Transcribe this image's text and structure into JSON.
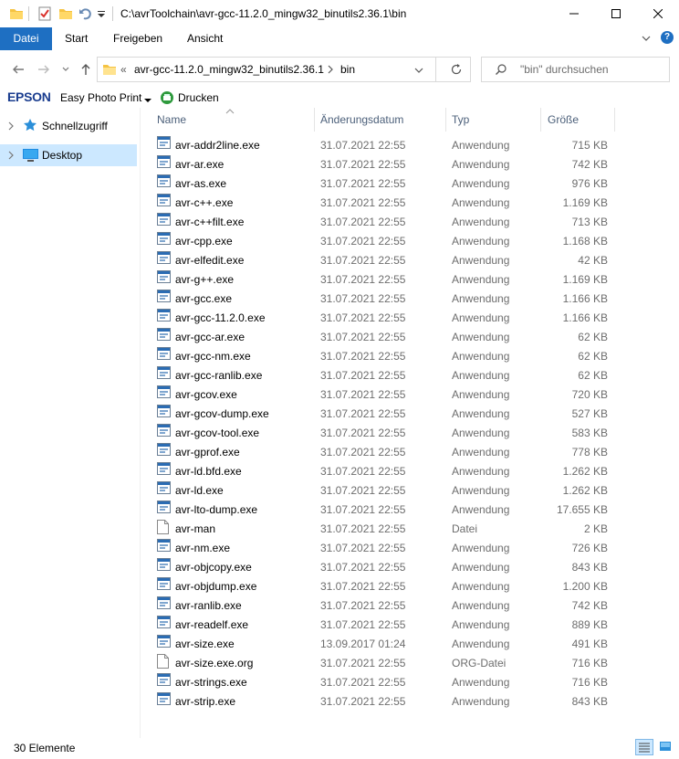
{
  "window": {
    "title": "C:\\avrToolchain\\avr-gcc-11.2.0_mingw32_binutils2.36.1\\bin"
  },
  "ribbon": {
    "tabs": [
      "Datei",
      "Start",
      "Freigeben",
      "Ansicht"
    ]
  },
  "address": {
    "overflow": "«",
    "crumbs": [
      "avr-gcc-11.2.0_mingw32_binutils2.36.1",
      "bin"
    ],
    "search_placeholder": "\"bin\" durchsuchen"
  },
  "toolbar": {
    "epson": "EPSON",
    "easy_photo_print": "Easy Photo Print",
    "print": "Drucken"
  },
  "nav": {
    "items": [
      "Schnellzugriff",
      "Desktop"
    ]
  },
  "columns": {
    "name": "Name",
    "date": "Änderungsdatum",
    "type": "Typ",
    "size": "Größe"
  },
  "files": [
    {
      "name": "avr-addr2line.exe",
      "date": "31.07.2021 22:55",
      "type": "Anwendung",
      "size": "715 KB",
      "icon": "exe"
    },
    {
      "name": "avr-ar.exe",
      "date": "31.07.2021 22:55",
      "type": "Anwendung",
      "size": "742 KB",
      "icon": "exe"
    },
    {
      "name": "avr-as.exe",
      "date": "31.07.2021 22:55",
      "type": "Anwendung",
      "size": "976 KB",
      "icon": "exe"
    },
    {
      "name": "avr-c++.exe",
      "date": "31.07.2021 22:55",
      "type": "Anwendung",
      "size": "1.169 KB",
      "icon": "exe"
    },
    {
      "name": "avr-c++filt.exe",
      "date": "31.07.2021 22:55",
      "type": "Anwendung",
      "size": "713 KB",
      "icon": "exe"
    },
    {
      "name": "avr-cpp.exe",
      "date": "31.07.2021 22:55",
      "type": "Anwendung",
      "size": "1.168 KB",
      "icon": "exe"
    },
    {
      "name": "avr-elfedit.exe",
      "date": "31.07.2021 22:55",
      "type": "Anwendung",
      "size": "42 KB",
      "icon": "exe"
    },
    {
      "name": "avr-g++.exe",
      "date": "31.07.2021 22:55",
      "type": "Anwendung",
      "size": "1.169 KB",
      "icon": "exe"
    },
    {
      "name": "avr-gcc.exe",
      "date": "31.07.2021 22:55",
      "type": "Anwendung",
      "size": "1.166 KB",
      "icon": "exe"
    },
    {
      "name": "avr-gcc-11.2.0.exe",
      "date": "31.07.2021 22:55",
      "type": "Anwendung",
      "size": "1.166 KB",
      "icon": "exe"
    },
    {
      "name": "avr-gcc-ar.exe",
      "date": "31.07.2021 22:55",
      "type": "Anwendung",
      "size": "62 KB",
      "icon": "exe"
    },
    {
      "name": "avr-gcc-nm.exe",
      "date": "31.07.2021 22:55",
      "type": "Anwendung",
      "size": "62 KB",
      "icon": "exe"
    },
    {
      "name": "avr-gcc-ranlib.exe",
      "date": "31.07.2021 22:55",
      "type": "Anwendung",
      "size": "62 KB",
      "icon": "exe"
    },
    {
      "name": "avr-gcov.exe",
      "date": "31.07.2021 22:55",
      "type": "Anwendung",
      "size": "720 KB",
      "icon": "exe"
    },
    {
      "name": "avr-gcov-dump.exe",
      "date": "31.07.2021 22:55",
      "type": "Anwendung",
      "size": "527 KB",
      "icon": "exe"
    },
    {
      "name": "avr-gcov-tool.exe",
      "date": "31.07.2021 22:55",
      "type": "Anwendung",
      "size": "583 KB",
      "icon": "exe"
    },
    {
      "name": "avr-gprof.exe",
      "date": "31.07.2021 22:55",
      "type": "Anwendung",
      "size": "778 KB",
      "icon": "exe"
    },
    {
      "name": "avr-ld.bfd.exe",
      "date": "31.07.2021 22:55",
      "type": "Anwendung",
      "size": "1.262 KB",
      "icon": "exe"
    },
    {
      "name": "avr-ld.exe",
      "date": "31.07.2021 22:55",
      "type": "Anwendung",
      "size": "1.262 KB",
      "icon": "exe"
    },
    {
      "name": "avr-lto-dump.exe",
      "date": "31.07.2021 22:55",
      "type": "Anwendung",
      "size": "17.655 KB",
      "icon": "exe"
    },
    {
      "name": "avr-man",
      "date": "31.07.2021 22:55",
      "type": "Datei",
      "size": "2 KB",
      "icon": "file"
    },
    {
      "name": "avr-nm.exe",
      "date": "31.07.2021 22:55",
      "type": "Anwendung",
      "size": "726 KB",
      "icon": "exe"
    },
    {
      "name": "avr-objcopy.exe",
      "date": "31.07.2021 22:55",
      "type": "Anwendung",
      "size": "843 KB",
      "icon": "exe"
    },
    {
      "name": "avr-objdump.exe",
      "date": "31.07.2021 22:55",
      "type": "Anwendung",
      "size": "1.200 KB",
      "icon": "exe"
    },
    {
      "name": "avr-ranlib.exe",
      "date": "31.07.2021 22:55",
      "type": "Anwendung",
      "size": "742 KB",
      "icon": "exe"
    },
    {
      "name": "avr-readelf.exe",
      "date": "31.07.2021 22:55",
      "type": "Anwendung",
      "size": "889 KB",
      "icon": "exe"
    },
    {
      "name": "avr-size.exe",
      "date": "13.09.2017 01:24",
      "type": "Anwendung",
      "size": "491 KB",
      "icon": "exe"
    },
    {
      "name": "avr-size.exe.org",
      "date": "31.07.2021 22:55",
      "type": "ORG-Datei",
      "size": "716 KB",
      "icon": "file"
    },
    {
      "name": "avr-strings.exe",
      "date": "31.07.2021 22:55",
      "type": "Anwendung",
      "size": "716 KB",
      "icon": "exe"
    },
    {
      "name": "avr-strip.exe",
      "date": "31.07.2021 22:55",
      "type": "Anwendung",
      "size": "843 KB",
      "icon": "exe"
    }
  ],
  "status": {
    "count": "30 Elemente"
  },
  "colors": {
    "accent": "#1e6fc2",
    "selection": "#cce8ff",
    "folder": "#f5c342"
  }
}
